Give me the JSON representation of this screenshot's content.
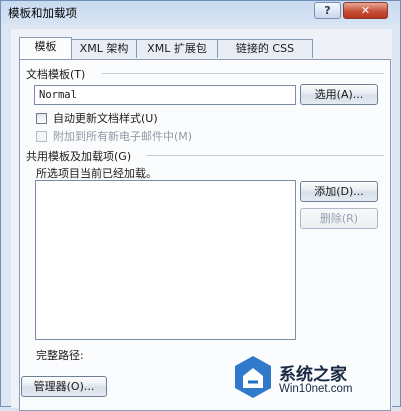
{
  "window": {
    "title": "模板和加载项",
    "help_glyph": "?",
    "close_glyph": "✕"
  },
  "tabs": [
    {
      "label": "模板",
      "active": true
    },
    {
      "label": "XML 架构",
      "active": false
    },
    {
      "label": "XML 扩展包",
      "active": false
    },
    {
      "label": "链接的 CSS",
      "active": false
    }
  ],
  "doc_template": {
    "group_label": "文档模板(T)",
    "value": "Normal",
    "select_button": "选用(A)...",
    "auto_update_label": "自动更新文档样式(U)",
    "auto_update_checked": false,
    "attach_email_label": "附加到所有新电子邮件中(M)",
    "attach_email_checked": false,
    "attach_email_enabled": false
  },
  "global_templates": {
    "group_label": "共用模板及加载项(G)",
    "caption": "所选项目当前已经加载。",
    "items": [],
    "add_button": "添加(D)...",
    "remove_button": "删除(R)",
    "full_path_label": "完整路径:"
  },
  "footer": {
    "organizer_button": "管理器(O)..."
  },
  "watermark": {
    "brand": "系统之家",
    "url": "Win10net.com"
  },
  "colors": {
    "title_bg": "#c9daf0",
    "close_red": "#c7503a",
    "panel_bg": "#eef2f8",
    "watermark_blue": "#1e6fc8"
  }
}
